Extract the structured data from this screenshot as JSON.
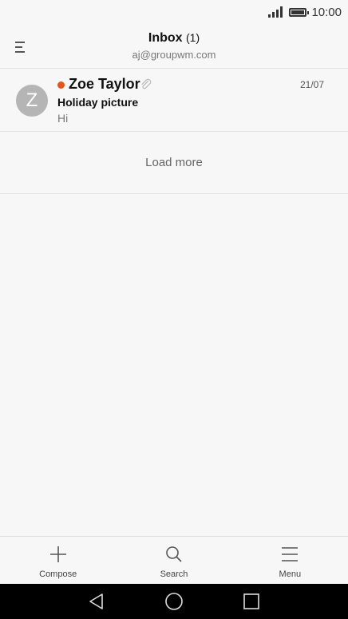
{
  "status": {
    "time": "10:00"
  },
  "header": {
    "title": "Inbox",
    "count": "(1)",
    "account": "aj@groupwm.com"
  },
  "emails": [
    {
      "avatar_letter": "Z",
      "sender": "Zoe Taylor",
      "date": "21/07",
      "subject": "Holiday picture",
      "preview": "Hi",
      "unread": true,
      "has_attachment": true
    }
  ],
  "load_more": "Load more",
  "toolbar": {
    "compose": "Compose",
    "search": "Search",
    "menu": "Menu"
  },
  "colors": {
    "unread_dot": "#e5541c",
    "avatar_bg": "#b5b5b5",
    "background": "#f7f7f7"
  }
}
